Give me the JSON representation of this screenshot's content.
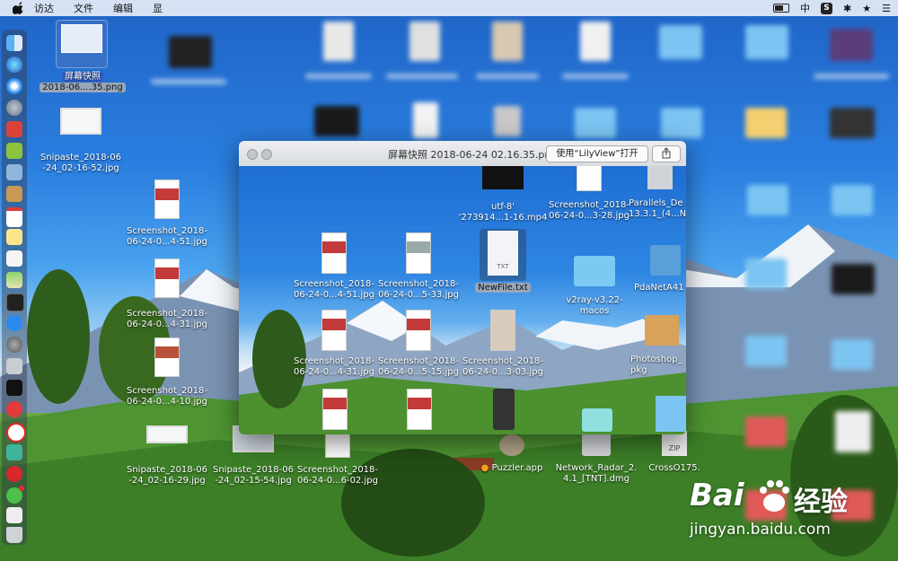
{
  "menubar": {
    "items": [
      "访达",
      "文件",
      "编辑",
      "显"
    ],
    "input_method": "中"
  },
  "selected_file": {
    "name": "屏幕快照",
    "path": "2018-06....35.png"
  },
  "desktop_files": [
    {
      "name": "Snipaste_2018-06\n-24_02-16-52.jpg"
    },
    {
      "name": "Screenshot_2018-\n06-24-0...4-51.jpg"
    },
    {
      "name": "Screenshot_2018-\n06-24-0...4-31.jpg"
    },
    {
      "name": "Screenshot_2018-\n06-24-0...4-10.jpg"
    },
    {
      "name": "Snipaste_2018-06\n-24_02-16-29.jpg"
    },
    {
      "name": "Snipaste_2018-06\n-24_02-15-54.jpg"
    },
    {
      "name": "Screenshot_2018-\n06-24-0...6-02.jpg"
    },
    {
      "name": "Puzzler.app"
    },
    {
      "name": "Network_Radar_2.\n4.1_[TNT].dmg"
    },
    {
      "name": "CrossO175."
    }
  ],
  "quicklook": {
    "title": "屏幕快照 2018-06-24 02.16.35.png",
    "open_button": "使用“LilyView”打开",
    "files": [
      {
        "name": "utf-8'\n'273914...1-16.mp4"
      },
      {
        "name": "Screenshot_2018-\n06-24-0...3-28.jpg"
      },
      {
        "name": "Parallels_De\n13.3.1_(4...N"
      },
      {
        "name": "Screenshot_2018-\n06-24-0...4-51.jpg"
      },
      {
        "name": "Screenshot_2018-\n06-24-0...5-33.jpg"
      },
      {
        "name": "NewFile.txt"
      },
      {
        "name": "v2ray-v3.22-\nmacos"
      },
      {
        "name": "PdaNetA41"
      },
      {
        "name": "Screenshot_2018-\n06-24-0...4-31.jpg"
      },
      {
        "name": "Screenshot_2018-\n06-24-0...5-15.jpg"
      },
      {
        "name": "Screenshot_2018-\n06-24-0...3-03.jpg"
      },
      {
        "name": "Photoshop_\npkg"
      }
    ],
    "txt_label": "TXT",
    "zip_label": "ZIP"
  },
  "watermark": {
    "brand": "Bai",
    "brand_cn": "经验",
    "url": "jingyan.baidu.com"
  },
  "icons": [
    "apple-icon",
    "battery-icon",
    "bluetooth-icon",
    "star-icon",
    "menu-list-icon",
    "finder-icon",
    "siri-icon",
    "safari-icon",
    "launchpad-icon",
    "share-icon"
  ],
  "colors": {
    "menubar": "#e6ecf6",
    "selection": "#2f5ec4",
    "accent_red": "#c23a3a"
  }
}
